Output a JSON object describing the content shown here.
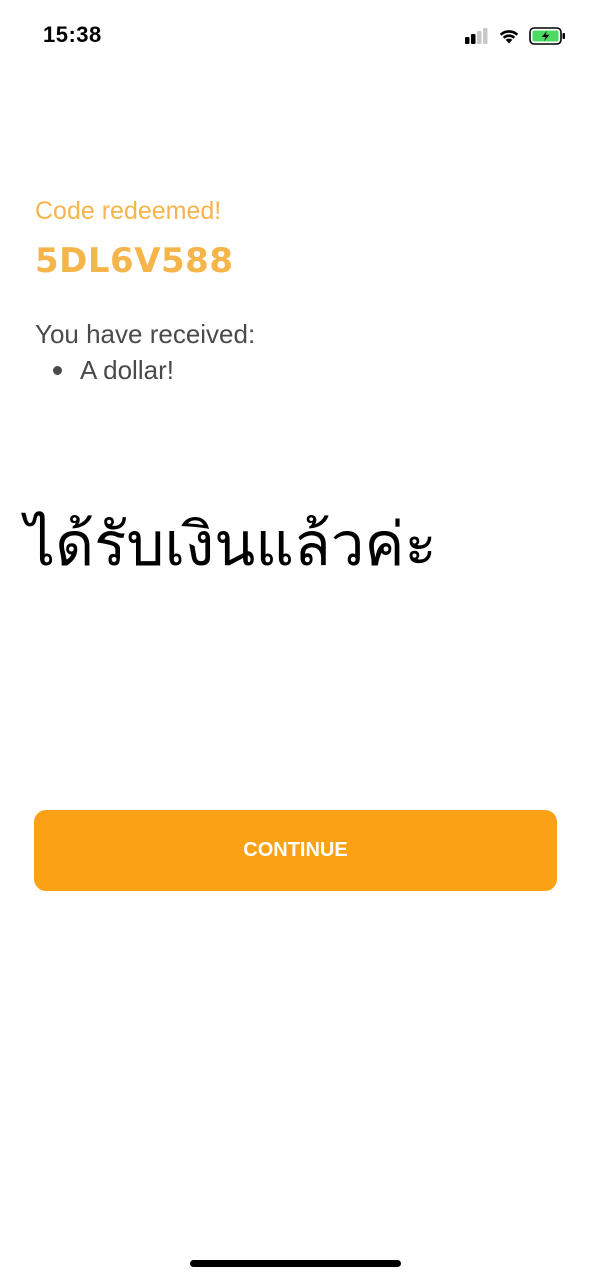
{
  "status_bar": {
    "time": "15:38",
    "icons": [
      "signal-icon",
      "wifi-icon",
      "battery-charging-icon"
    ],
    "battery_color": "#4cd964"
  },
  "redeem": {
    "title": "Code redeemed!",
    "code": "5DL6V588",
    "received_label": "You have received:",
    "items": [
      "A dollar!"
    ]
  },
  "overlay_text": "ได้รับเงินแล้วค่ะ",
  "actions": {
    "continue_label": "CONTINUE"
  },
  "colors": {
    "accent_text": "#f5b54a",
    "button": "#fba214",
    "body_text": "#4a4a4a"
  }
}
